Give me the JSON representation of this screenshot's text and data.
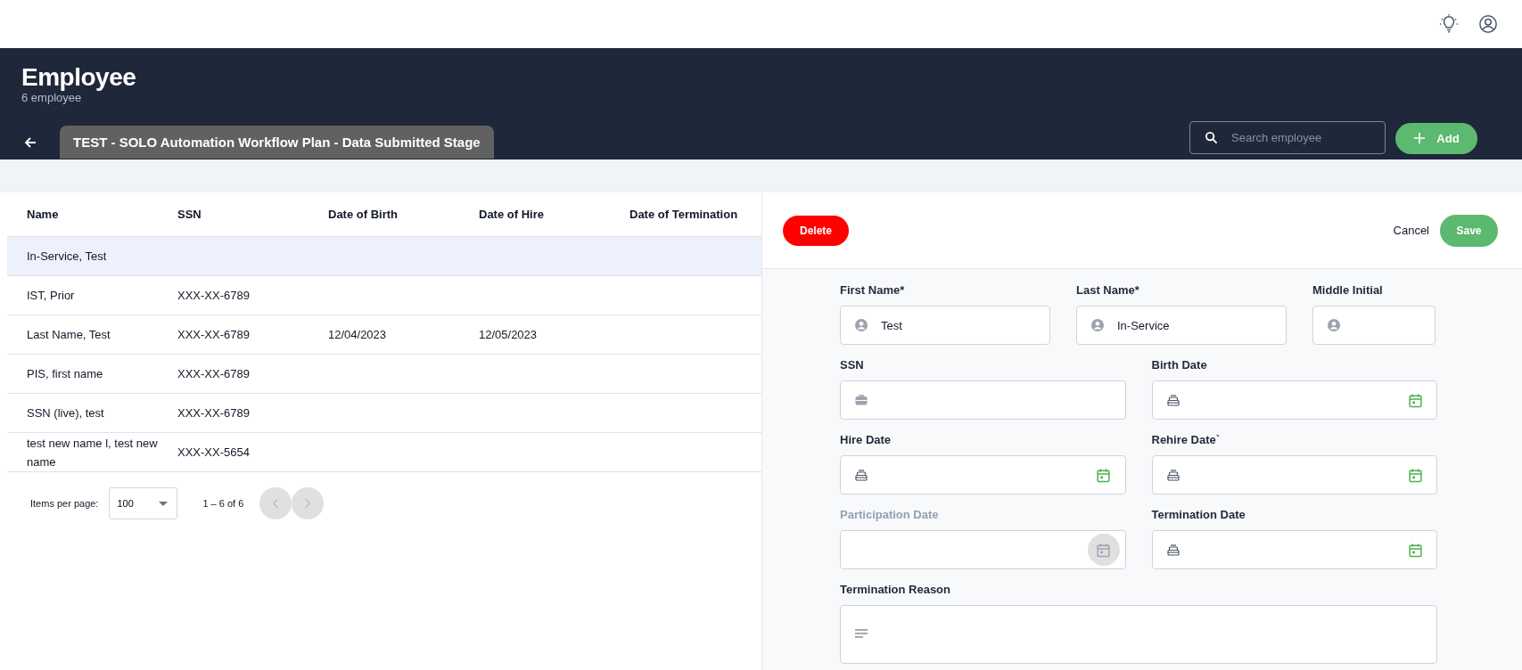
{
  "header": {
    "title": "Employee",
    "subtitle": "6 employee",
    "plan_tab": "TEST - SOLO Automation Workflow Plan - Data Submitted Stage",
    "search": {
      "placeholder": "Search employee"
    },
    "add_button": "Add"
  },
  "table": {
    "columns": [
      "Name",
      "SSN",
      "Date of Birth",
      "Date of Hire",
      "Date of Termination"
    ],
    "rows": [
      {
        "selected": true,
        "cells": [
          "In-Service, Test",
          "",
          "",
          "",
          ""
        ]
      },
      {
        "selected": false,
        "cells": [
          "IST, Prior",
          "XXX-XX-6789",
          "",
          "",
          ""
        ]
      },
      {
        "selected": false,
        "cells": [
          "Last Name, Test",
          "XXX-XX-6789",
          "12/04/2023",
          "12/05/2023",
          ""
        ]
      },
      {
        "selected": false,
        "cells": [
          "PIS, first name",
          "XXX-XX-6789",
          "",
          "",
          ""
        ]
      },
      {
        "selected": false,
        "cells": [
          "SSN (live), test",
          "XXX-XX-6789",
          "",
          "",
          ""
        ]
      },
      {
        "selected": false,
        "cells": [
          "test new name l, test new name",
          "XXX-XX-5654",
          "",
          "",
          ""
        ]
      }
    ]
  },
  "pagination": {
    "items_per_page_label": "Items per page:",
    "page_size": "100",
    "range": "1 – 6 of 6",
    "previous": {
      "disabled": true
    },
    "next": {
      "disabled": true
    }
  },
  "form": {
    "delete_button": "Delete",
    "cancel_button": "Cancel",
    "save_button": "Save",
    "rows": [
      [
        {
          "label": "First Name*",
          "kind": "name",
          "value": "Test",
          "disabled": false
        },
        {
          "label": "Last Name*",
          "kind": "name",
          "value": "In-Service",
          "disabled": false
        },
        {
          "label": "Middle Initial",
          "kind": "name",
          "disabled": false
        }
      ],
      [
        {
          "label": "SSN",
          "kind": "ssn",
          "disabled": false
        },
        {
          "label": "Birth Date",
          "kind": "date",
          "disabled": false
        }
      ],
      [
        {
          "label": "Hire Date",
          "kind": "date",
          "disabled": false
        },
        {
          "label": "Rehire Date`",
          "kind": "date",
          "disabled": false
        }
      ],
      [
        {
          "label": "Participation Date",
          "kind": "date",
          "disabled": true
        },
        {
          "label": "Termination Date",
          "kind": "date",
          "disabled": false
        }
      ],
      [
        {
          "label": "Termination Reason",
          "kind": "text",
          "disabled": false
        }
      ]
    ]
  }
}
